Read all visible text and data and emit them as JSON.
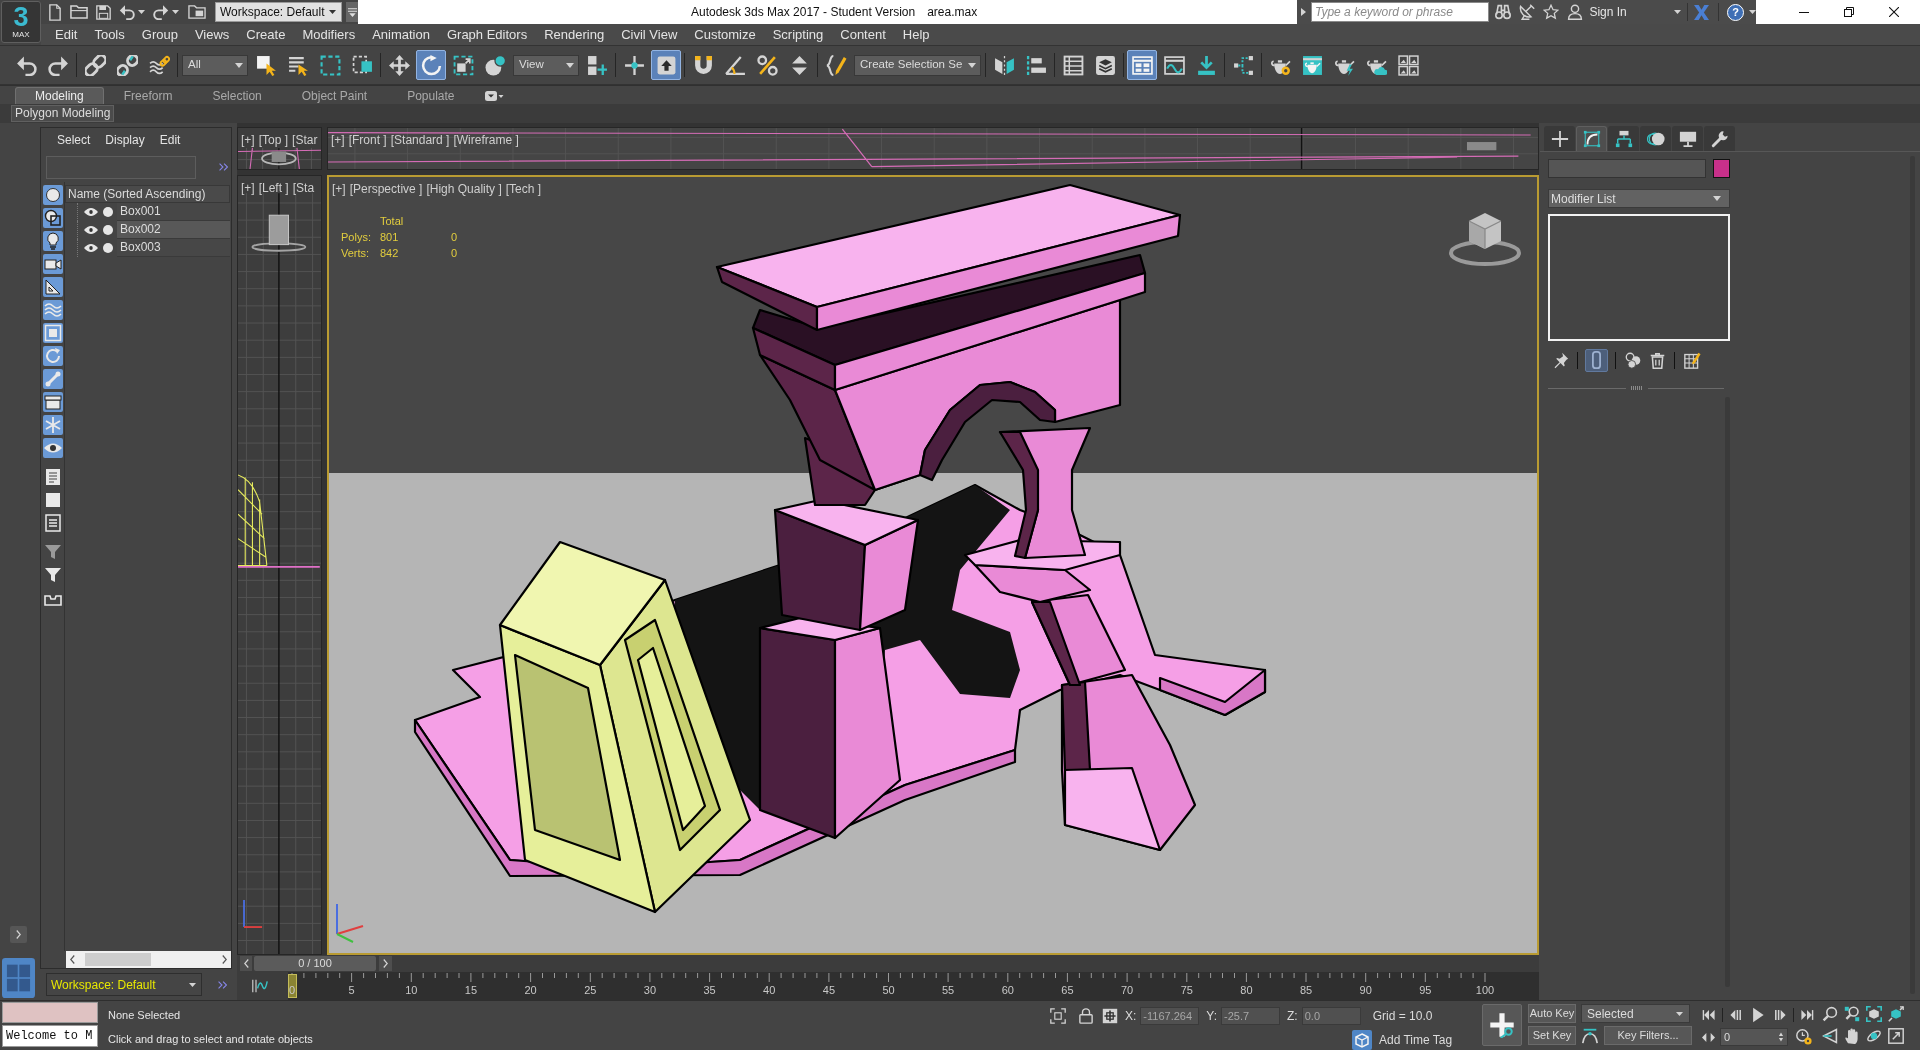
{
  "app_button": {
    "mark": "3",
    "label": "MAX"
  },
  "title_bar": {
    "workspace": "Workspace: Default",
    "title": "Autodesk 3ds Max 2017 - Student Version",
    "file": "area.max",
    "search": {
      "placeholder": "Type a keyword or phrase"
    },
    "sign_in": "Sign In",
    "help": "?"
  },
  "menu": [
    "Edit",
    "Tools",
    "Group",
    "Views",
    "Create",
    "Modifiers",
    "Animation",
    "Graph Editors",
    "Rendering",
    "Civil View",
    "Customize",
    "Scripting",
    "Content",
    "Help"
  ],
  "toolbar": [
    [
      {
        "kind": "undo",
        "active": false
      },
      {
        "kind": "redo",
        "active": false
      }
    ],
    [
      {
        "kind": "link",
        "active": false
      },
      {
        "kind": "unlink",
        "active": false
      },
      {
        "kind": "bind_space_warp",
        "active": false
      }
    ],
    [
      {
        "kind": "dropdown",
        "value": "All",
        "active": false
      },
      {
        "kind": "select_object",
        "active": false
      },
      {
        "kind": "select_by_name",
        "active": false
      },
      {
        "kind": "rectangle_region",
        "active": false
      },
      {
        "kind": "window_crossing",
        "active": false
      }
    ],
    [
      {
        "kind": "move",
        "active": false
      },
      {
        "kind": "rotate",
        "active": true
      },
      {
        "kind": "scale",
        "active": false
      },
      {
        "kind": "placement",
        "active": false
      },
      {
        "kind": "dropdown",
        "value": "View",
        "active": false
      },
      {
        "kind": "pivot",
        "active": false
      }
    ],
    [
      {
        "kind": "manipulate",
        "active": false
      },
      {
        "kind": "keyboard_override",
        "active": true
      }
    ],
    [
      {
        "kind": "snaps",
        "active": false
      },
      {
        "kind": "angle_snap",
        "active": false
      },
      {
        "kind": "percent_snap",
        "active": false
      },
      {
        "kind": "spinner_snap",
        "active": false
      }
    ],
    [
      {
        "kind": "named_selection",
        "active": false
      },
      {
        "kind": "dropdown",
        "value": "Create Selection Se",
        "active": false
      }
    ],
    [
      {
        "kind": "mirror",
        "active": false
      },
      {
        "kind": "align",
        "active": false
      }
    ],
    [
      {
        "kind": "scene_explorer",
        "active": false
      },
      {
        "kind": "layer_explorer",
        "active": false
      }
    ],
    [
      {
        "kind": "ribbon",
        "active": true
      },
      {
        "kind": "curve_editor",
        "active": false
      },
      {
        "kind": "dope_sheet",
        "active": false
      }
    ],
    [
      {
        "kind": "schematic",
        "active": false
      }
    ],
    [
      {
        "kind": "material_editor",
        "active": false
      },
      {
        "kind": "render_setup",
        "active": false
      },
      {
        "kind": "render",
        "active": false
      },
      {
        "kind": "render_cloud",
        "active": false
      },
      {
        "kind": "gallery",
        "active": false
      }
    ]
  ],
  "ribbon": {
    "tabs": [
      {
        "label": "Modeling",
        "selected": true
      },
      {
        "label": "Freeform",
        "selected": false
      },
      {
        "label": "Selection",
        "selected": false
      },
      {
        "label": "Object Paint",
        "selected": false
      },
      {
        "label": "Populate",
        "selected": false
      }
    ],
    "panel": "Polygon Modeling"
  },
  "scene_explorer": {
    "menu": [
      "Select",
      "Display",
      "Edit"
    ],
    "filter_groups": [
      [
        {
          "kind": "geometry",
          "on": true
        },
        {
          "kind": "shapes",
          "on": true
        },
        {
          "kind": "lights",
          "on": true
        },
        {
          "kind": "cameras",
          "on": true
        },
        {
          "kind": "helpers",
          "on": true
        },
        {
          "kind": "space_warps",
          "on": true
        },
        {
          "kind": "groups",
          "on": true
        },
        {
          "kind": "xrefs",
          "on": true
        },
        {
          "kind": "bones",
          "on": true
        },
        {
          "kind": "containers",
          "on": true
        },
        {
          "kind": "frozen",
          "on": true
        },
        {
          "kind": "hidden",
          "on": true
        }
      ],
      [
        {
          "kind": "details",
          "on": false
        },
        {
          "kind": "square",
          "on": false
        },
        {
          "kind": "framed",
          "on": false
        }
      ],
      [
        {
          "kind": "filter_settings",
          "on": false
        },
        {
          "kind": "filter",
          "on": false
        },
        {
          "kind": "tray",
          "on": false
        }
      ]
    ],
    "column": "Name (Sorted Ascending)",
    "rows": [
      {
        "name": "Box001",
        "highlighted": false
      },
      {
        "name": "Box002",
        "highlighted": true
      },
      {
        "name": "Box003",
        "highlighted": false
      }
    ],
    "workspace": "Workspace: Default"
  },
  "viewports": [
    {
      "kind": "top",
      "active": false,
      "labels": [
        "[+]",
        "[Top ]",
        "[Star"
      ]
    },
    {
      "kind": "front",
      "active": false,
      "labels": [
        "[+]",
        "[Front ]",
        "[Standard ]",
        "[Wireframe ]"
      ]
    },
    {
      "kind": "left",
      "active": false,
      "labels": [
        "[+]",
        "[Left ]",
        "[Sta"
      ]
    },
    {
      "kind": "perspective",
      "active": true,
      "labels": [
        "[+]",
        "[Perspective ]",
        "[High Quality ]",
        "[Tech ]"
      ],
      "stats": {
        "header": "Total",
        "rows": [
          {
            "label": "Polys:",
            "total": "801",
            "selection": "0"
          },
          {
            "label": "Verts:",
            "total": "842",
            "selection": "0"
          }
        ]
      }
    }
  ],
  "time_slider": {
    "label": "0 / 100"
  },
  "track_bar": {
    "level": 0,
    "labels": [
      "0",
      "5",
      "10",
      "15",
      "20",
      "25",
      "30",
      "35",
      "40",
      "45",
      "50",
      "55",
      "60",
      "65",
      "70",
      "75",
      "80",
      "85",
      "90",
      "95",
      "100"
    ]
  },
  "command_panel": {
    "tabs": [
      {
        "kind": "create",
        "selected": false
      },
      {
        "kind": "modify",
        "selected": true
      },
      {
        "kind": "hierarchy",
        "selected": false
      },
      {
        "kind": "motion",
        "selected": false
      },
      {
        "kind": "display",
        "selected": false
      },
      {
        "kind": "utilities",
        "selected": false
      }
    ],
    "modifier_list": "Modifier List",
    "stack_buttons": [
      [
        {
          "kind": "pin",
          "active": false
        }
      ],
      [
        {
          "kind": "end_result",
          "active": true
        }
      ],
      [
        {
          "kind": "make_unique",
          "active": false
        },
        {
          "kind": "remove",
          "active": false
        }
      ],
      [
        {
          "kind": "configure",
          "active": false
        }
      ]
    ]
  },
  "status_bar": {
    "listener": "Welcome to M",
    "selection": "None Selected",
    "prompt": "Click and drag to select and rotate objects",
    "coordinates": [
      {
        "axis": "X:",
        "value": "-1167.264",
        "disabled": true
      },
      {
        "axis": "Y:",
        "value": "-25.7",
        "disabled": true
      },
      {
        "axis": "Z:",
        "value": "0.0",
        "disabled": true
      }
    ],
    "grid": "Grid = 10.0",
    "time_tag": "Add Time Tag"
  },
  "animation_controls": {
    "auto_key": "Auto Key",
    "set_key": "Set Key",
    "key_set": "Selected",
    "key_filters": "Key Filters...",
    "frame": "0"
  }
}
